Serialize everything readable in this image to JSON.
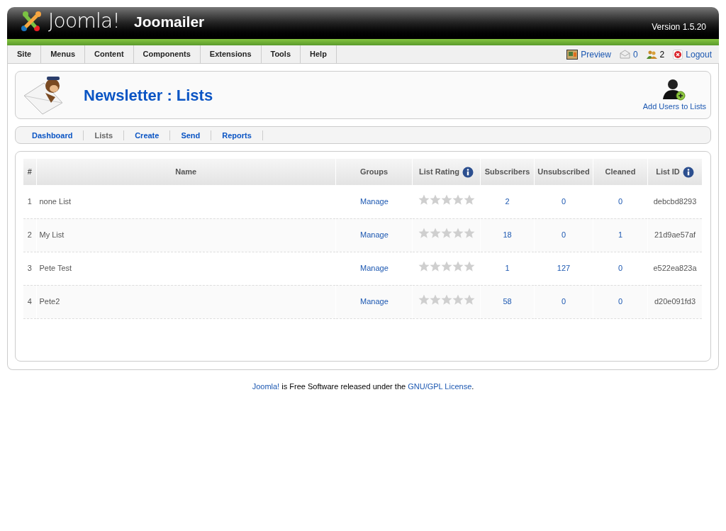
{
  "header": {
    "logo": "Joomla!",
    "app_title": "Joomailer",
    "version": "Version 1.5.20"
  },
  "menu": [
    "Site",
    "Menus",
    "Content",
    "Components",
    "Extensions",
    "Tools",
    "Help"
  ],
  "status": {
    "preview": "Preview",
    "messages": "0",
    "users": "2",
    "logout": "Logout"
  },
  "toolbar": {
    "title": "Newsletter : Lists",
    "action": "Add Users to Lists"
  },
  "submenu": [
    {
      "label": "Dashboard",
      "selected": false
    },
    {
      "label": "Lists",
      "selected": true
    },
    {
      "label": "Create",
      "selected": false
    },
    {
      "label": "Send",
      "selected": false
    },
    {
      "label": "Reports",
      "selected": false
    }
  ],
  "table": {
    "columns": [
      {
        "label": "#",
        "info": false
      },
      {
        "label": "Name",
        "info": false
      },
      {
        "label": "Groups",
        "info": false
      },
      {
        "label": "List Rating",
        "info": true
      },
      {
        "label": "Subscribers",
        "info": false
      },
      {
        "label": "Unsubscribed",
        "info": false
      },
      {
        "label": "Cleaned",
        "info": false
      },
      {
        "label": "List ID",
        "info": true
      }
    ],
    "rows": [
      {
        "index": "1",
        "name": "none List",
        "groups": "Manage",
        "stars": 0,
        "subscribers": "2",
        "unsubscribed": "0",
        "cleaned": "0",
        "list_id": "debcbd8293"
      },
      {
        "index": "2",
        "name": "My List",
        "groups": "Manage",
        "stars": 0,
        "subscribers": "18",
        "unsubscribed": "0",
        "cleaned": "1",
        "list_id": "21d9ae57af"
      },
      {
        "index": "3",
        "name": "Pete Test",
        "groups": "Manage",
        "stars": 0,
        "subscribers": "1",
        "unsubscribed": "127",
        "cleaned": "0",
        "list_id": "e522ea823a"
      },
      {
        "index": "4",
        "name": "Pete2",
        "groups": "Manage",
        "stars": 0,
        "subscribers": "58",
        "unsubscribed": "0",
        "cleaned": "0",
        "list_id": "d20e091fd3"
      }
    ]
  },
  "footer": {
    "text_before": "Joomla!",
    "text_middle": "is Free Software released under the",
    "link": "GNU/GPL License",
    "text_after": "."
  }
}
